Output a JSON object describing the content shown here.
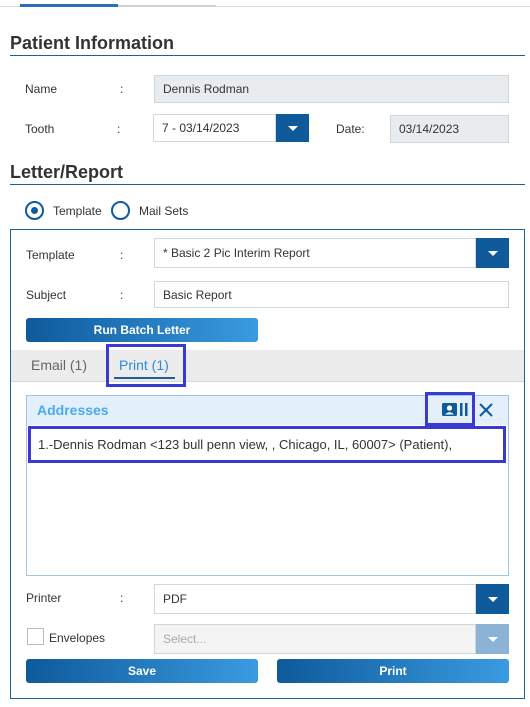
{
  "patient_info": {
    "title": "Patient Information",
    "name_label": "Name",
    "name_value": "Dennis Rodman",
    "tooth_label": "Tooth",
    "tooth_value": "7 - 03/14/2023",
    "date_label": "Date:",
    "date_value": "03/14/2023",
    "colon": ":"
  },
  "letter_report": {
    "title": "Letter/Report",
    "radio_template": "Template",
    "radio_mailsets": "Mail Sets",
    "selected_radio": "Template"
  },
  "form": {
    "template_label": "Template",
    "template_value": "* Basic 2 Pic Interim Report",
    "subject_label": "Subject",
    "subject_value": "Basic Report",
    "run_batch_label": "Run Batch Letter"
  },
  "tabs": [
    {
      "label": "Email (1)",
      "active": false
    },
    {
      "label": "Print (1)",
      "active": true
    }
  ],
  "addresses": {
    "title": "Addresses",
    "items": [
      "1.-Dennis Rodman <123 bull penn view, , Chicago, IL, 60007> (Patient),"
    ]
  },
  "printer": {
    "label": "Printer",
    "value": "PDF",
    "envelopes_label": "Envelopes",
    "envelopes_checked": false,
    "envelope_placeholder": "Select..."
  },
  "actions": {
    "save_label": "Save",
    "print_label": "Print"
  },
  "icons": {
    "address_book": "address-card-icon",
    "close": "close-icon",
    "dropdown": "chevron-down-icon"
  },
  "colors": {
    "primary": "#0e5a9b",
    "accent_light": "#3a9be0",
    "highlight": "#3a3ad0",
    "header_bg": "#e3f0fb"
  }
}
